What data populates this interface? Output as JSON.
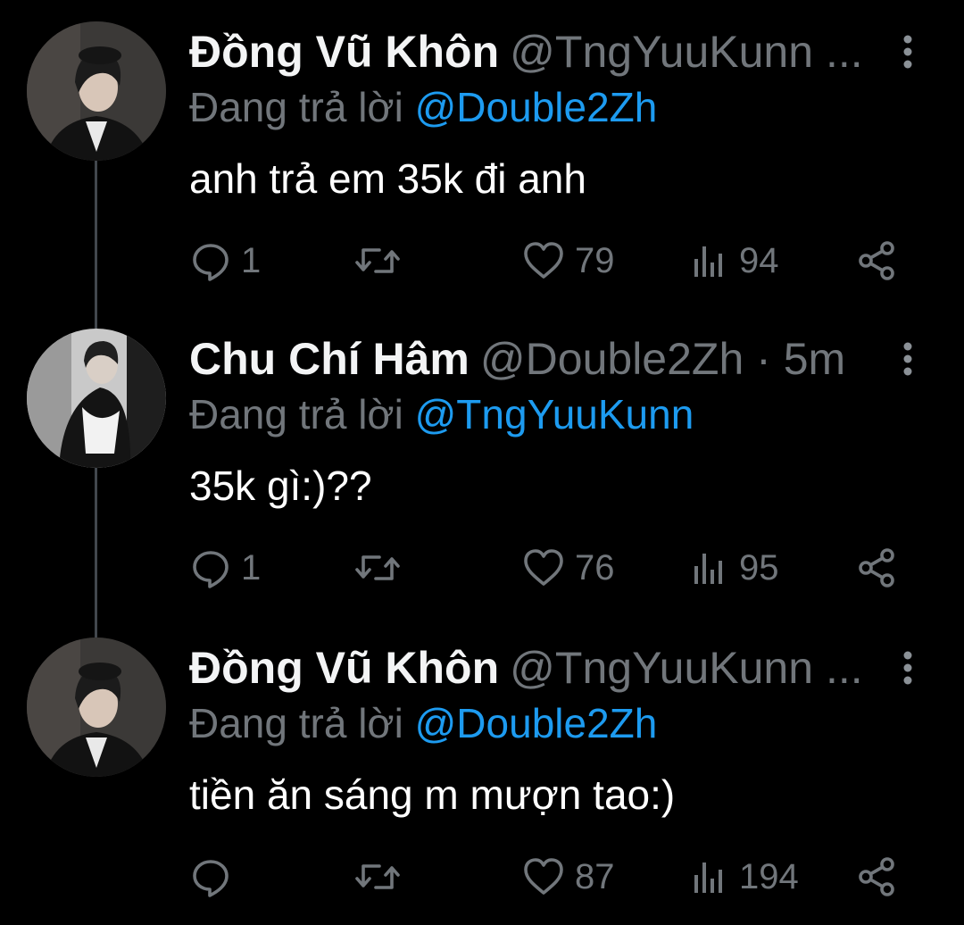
{
  "colors": {
    "background": "#000000",
    "name": "#f3f4f5",
    "secondary": "#71767b",
    "mention": "#1d9bf0",
    "thread_line": "#42474d"
  },
  "tweets": [
    {
      "author": "Đồng Vũ Khôn",
      "handle": "@TngYuuKunn ...",
      "replying_label": "Đang trả lời",
      "replying_to": "@Double2Zh",
      "text": "anh trả em 35k đi anh",
      "replies": "1",
      "likes": "79",
      "views": "94"
    },
    {
      "author": "Chu Chí Hâm",
      "handle": "@Double2Zh · 5m",
      "replying_label": "Đang trả lời",
      "replying_to": "@TngYuuKunn",
      "text": "35k gì:)??",
      "replies": "1",
      "likes": "76",
      "views": "95"
    },
    {
      "author": "Đồng Vũ Khôn",
      "handle": "@TngYuuKunn ...",
      "replying_label": "Đang trả lời",
      "replying_to": "@Double2Zh",
      "text": "tiền ăn sáng m mượn tao:)",
      "replies": "",
      "likes": "87",
      "views": "194"
    }
  ],
  "icons": {
    "more": "more-vertical-icon",
    "reply": "reply-icon",
    "retweet": "retweet-icon",
    "like": "heart-icon",
    "views": "views-icon",
    "share": "share-icon"
  }
}
